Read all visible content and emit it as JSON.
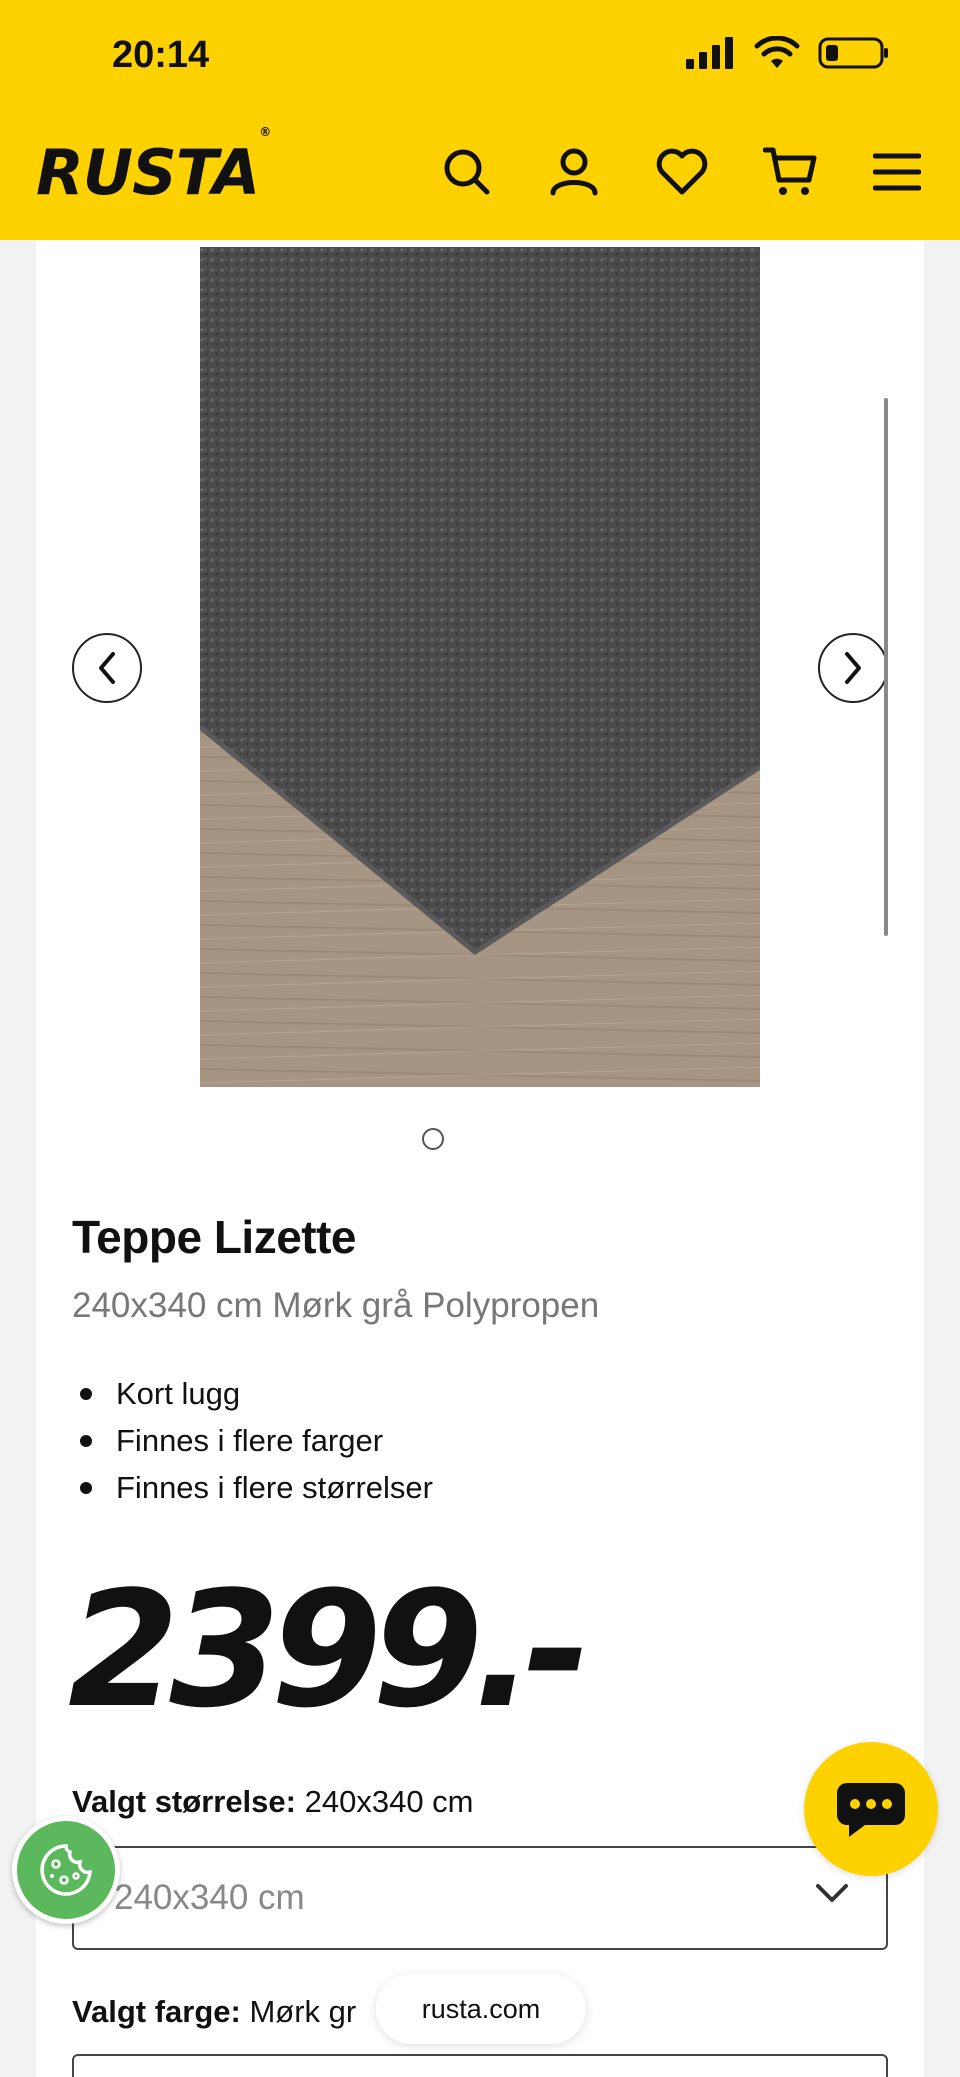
{
  "status_bar": {
    "time": "20:14"
  },
  "header": {
    "logo": "RUSTA",
    "logo_mark": "®",
    "icons": [
      "search-icon",
      "user-icon",
      "heart-icon",
      "cart-icon",
      "menu-icon"
    ]
  },
  "carousel": {
    "prev_icon": "chevron-left-icon",
    "next_icon": "chevron-right-icon"
  },
  "product": {
    "title": "Teppe Lizette",
    "subtitle": "240x340 cm Mørk grå Polypropen",
    "features": [
      "Kort lugg",
      "Finnes i flere farger",
      "Finnes i flere størrelser"
    ],
    "price": "2399.-"
  },
  "size": {
    "label": "Valgt størrelse:",
    "value": "240x340 cm",
    "select_value": "240x340 cm"
  },
  "color": {
    "label": "Valgt farge:",
    "value": "Mørk gr"
  },
  "floating": {
    "url": "rusta.com",
    "chat_icon": "chat-icon",
    "cookie_icon": "cookie-icon"
  },
  "colors": {
    "brand_yellow": "#fed100",
    "cookie_green": "#5cb85c"
  }
}
